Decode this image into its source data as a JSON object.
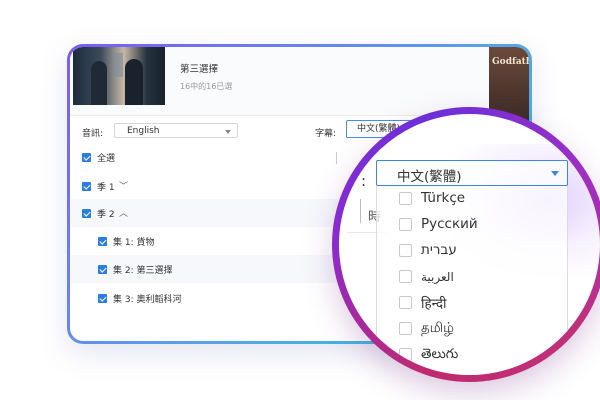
{
  "episode": {
    "title": "第三選擇",
    "subtitle": "16中的16已選"
  },
  "side_logo": "Godfath",
  "audio": {
    "label": "音訊:",
    "value": "English"
  },
  "subtitle_select": {
    "label": "字幕:",
    "value": "中文(繁體)"
  },
  "list": {
    "select_all": "全選",
    "season1": "季 1",
    "season2": "季 2",
    "episodes": [
      {
        "label": "集 1: 貨物"
      },
      {
        "label": "集 2: 第三選擇"
      },
      {
        "label": "集 3: 奧利韜科河"
      }
    ]
  },
  "magnifier": {
    "colon": ":",
    "selected": "中文(繁體)",
    "bg_fragment": "時",
    "options": [
      {
        "label": "Türkçe"
      },
      {
        "label": "Русский"
      },
      {
        "label": "עברית"
      },
      {
        "label": "العربية"
      },
      {
        "label": "हिन्दी"
      },
      {
        "label": "தமிழ்"
      },
      {
        "label": "తెలుగు"
      }
    ]
  },
  "colors": {
    "accent": "#2a7de1",
    "frame_start": "#7b5cf0",
    "frame_end": "#2cc9d8",
    "ring": "#8a2bd0"
  }
}
